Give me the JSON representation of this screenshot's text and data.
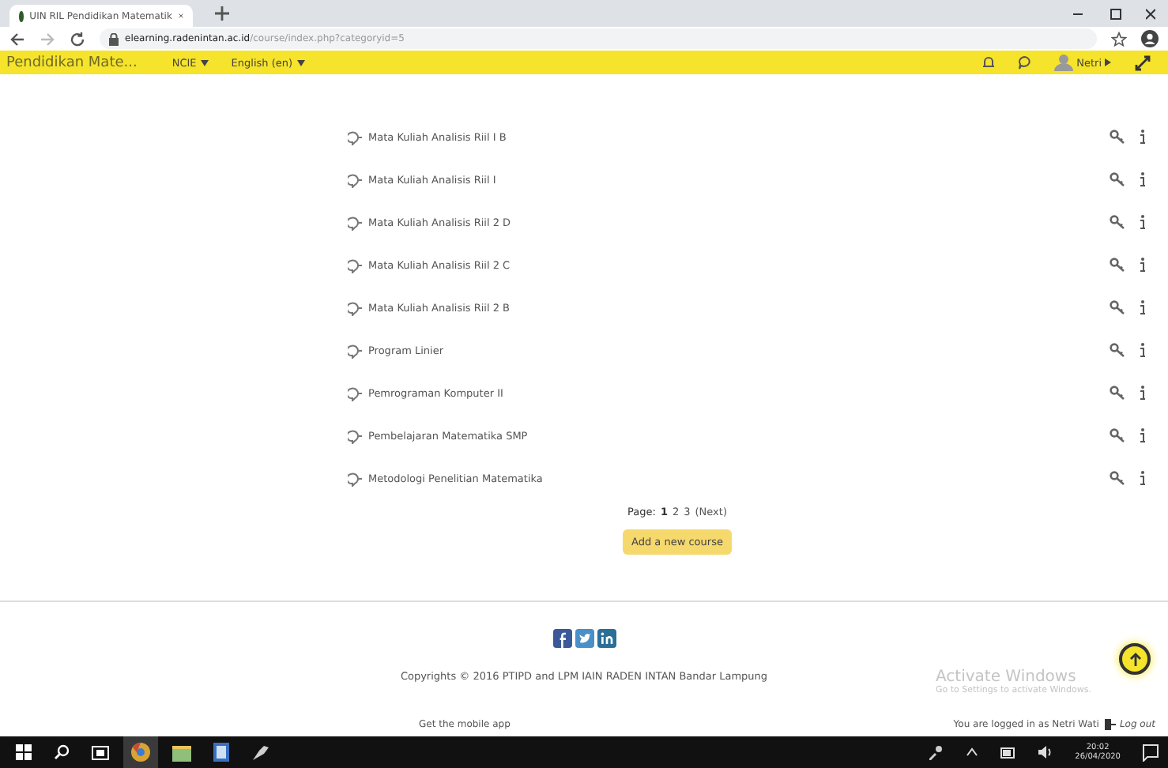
{
  "browser": {
    "tab_title": "UIN RIL Pendidikan Matematik",
    "url_host": "elearning.radenintan.ac.id",
    "url_path": "/course/index.php?categoryid=5"
  },
  "navbar": {
    "site_name": "Pendidikan Mate...",
    "menus": [
      "NCIE",
      "English (en)"
    ],
    "user": "Netri"
  },
  "courses": [
    {
      "name": "Mata Kuliah Analisis Riil I B"
    },
    {
      "name": "Mata Kuliah Analisis Riil I"
    },
    {
      "name": "Mata Kuliah Analisis Riil 2 D"
    },
    {
      "name": "Mata Kuliah Analisis Riil 2 C"
    },
    {
      "name": "Mata Kuliah Analisis Riil 2 B"
    },
    {
      "name": "Program Linier"
    },
    {
      "name": "Pemrograman Komputer II"
    },
    {
      "name": "Pembelajaran Matematika SMP"
    },
    {
      "name": "Metodologi Penelitian Matematika"
    }
  ],
  "pagination": {
    "label": "Page:",
    "pages": [
      {
        "label": "1",
        "selected": true
      },
      {
        "label": "2",
        "selected": false
      },
      {
        "label": "3",
        "selected": false
      }
    ],
    "next": "(Next)"
  },
  "add_button": "Add a new course",
  "footer": {
    "copyright": "Copyrights © 2016 PTIPD and LPM IAIN RADEN INTAN Bandar Lampung",
    "mobile_app": "Get the mobile app",
    "logged_in": "You are logged in as Netri Wati",
    "logout": "Log out"
  },
  "activation": {
    "title": "Activate Windows",
    "hint": "Go to Settings to activate Windows."
  },
  "taskbar": {
    "time": "20:02",
    "date": "26/04/2020"
  }
}
